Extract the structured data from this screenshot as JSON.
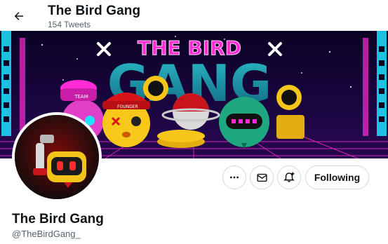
{
  "topbar": {
    "title": "The Bird Gang",
    "tweet_count": "154 Tweets"
  },
  "banner": {
    "headline_top": "THE BIRD",
    "headline_bottom": "GANG",
    "cap_text": "TEAM",
    "cap2_text": "FOUNDER",
    "colors": {
      "background": "#0b0224",
      "neon_pink": "#ff2bd6",
      "neon_cyan": "#1ee3ff",
      "gold": "#f5c51a"
    }
  },
  "profile": {
    "display_name": "The Bird Gang",
    "handle": "@TheBirdGang_"
  },
  "actions": {
    "more_icon": "more-icon",
    "message_icon": "envelope-icon",
    "notify_icon": "bell-plus-icon",
    "follow_label": "Following"
  }
}
